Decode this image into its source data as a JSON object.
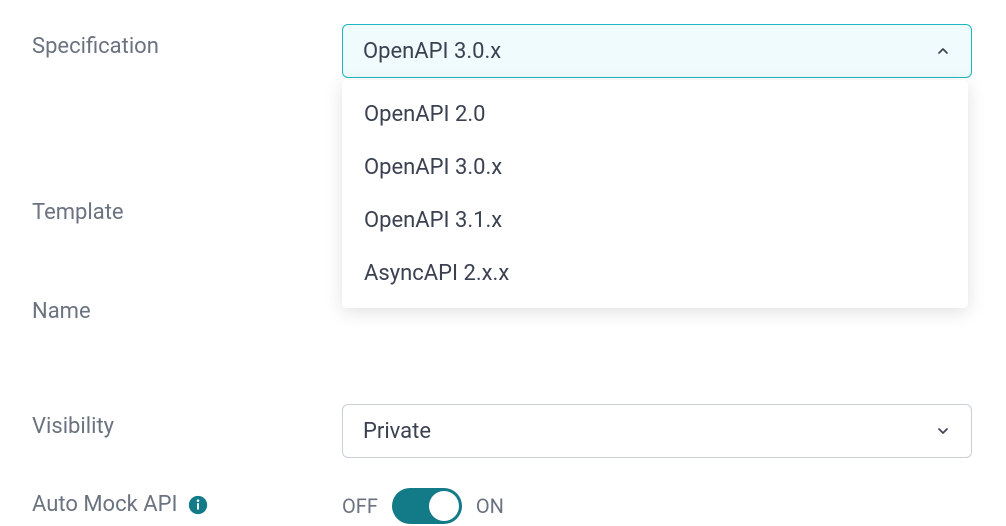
{
  "form": {
    "specification": {
      "label": "Specification",
      "selected": "OpenAPI 3.0.x",
      "options": [
        "OpenAPI 2.0",
        "OpenAPI 3.0.x",
        "OpenAPI 3.1.x",
        "AsyncAPI 2.x.x"
      ]
    },
    "template": {
      "label": "Template"
    },
    "name": {
      "label": "Name"
    },
    "visibility": {
      "label": "Visibility",
      "selected": "Private"
    },
    "autoMock": {
      "label": "Auto Mock API",
      "offText": "OFF",
      "onText": "ON",
      "value": true
    }
  }
}
